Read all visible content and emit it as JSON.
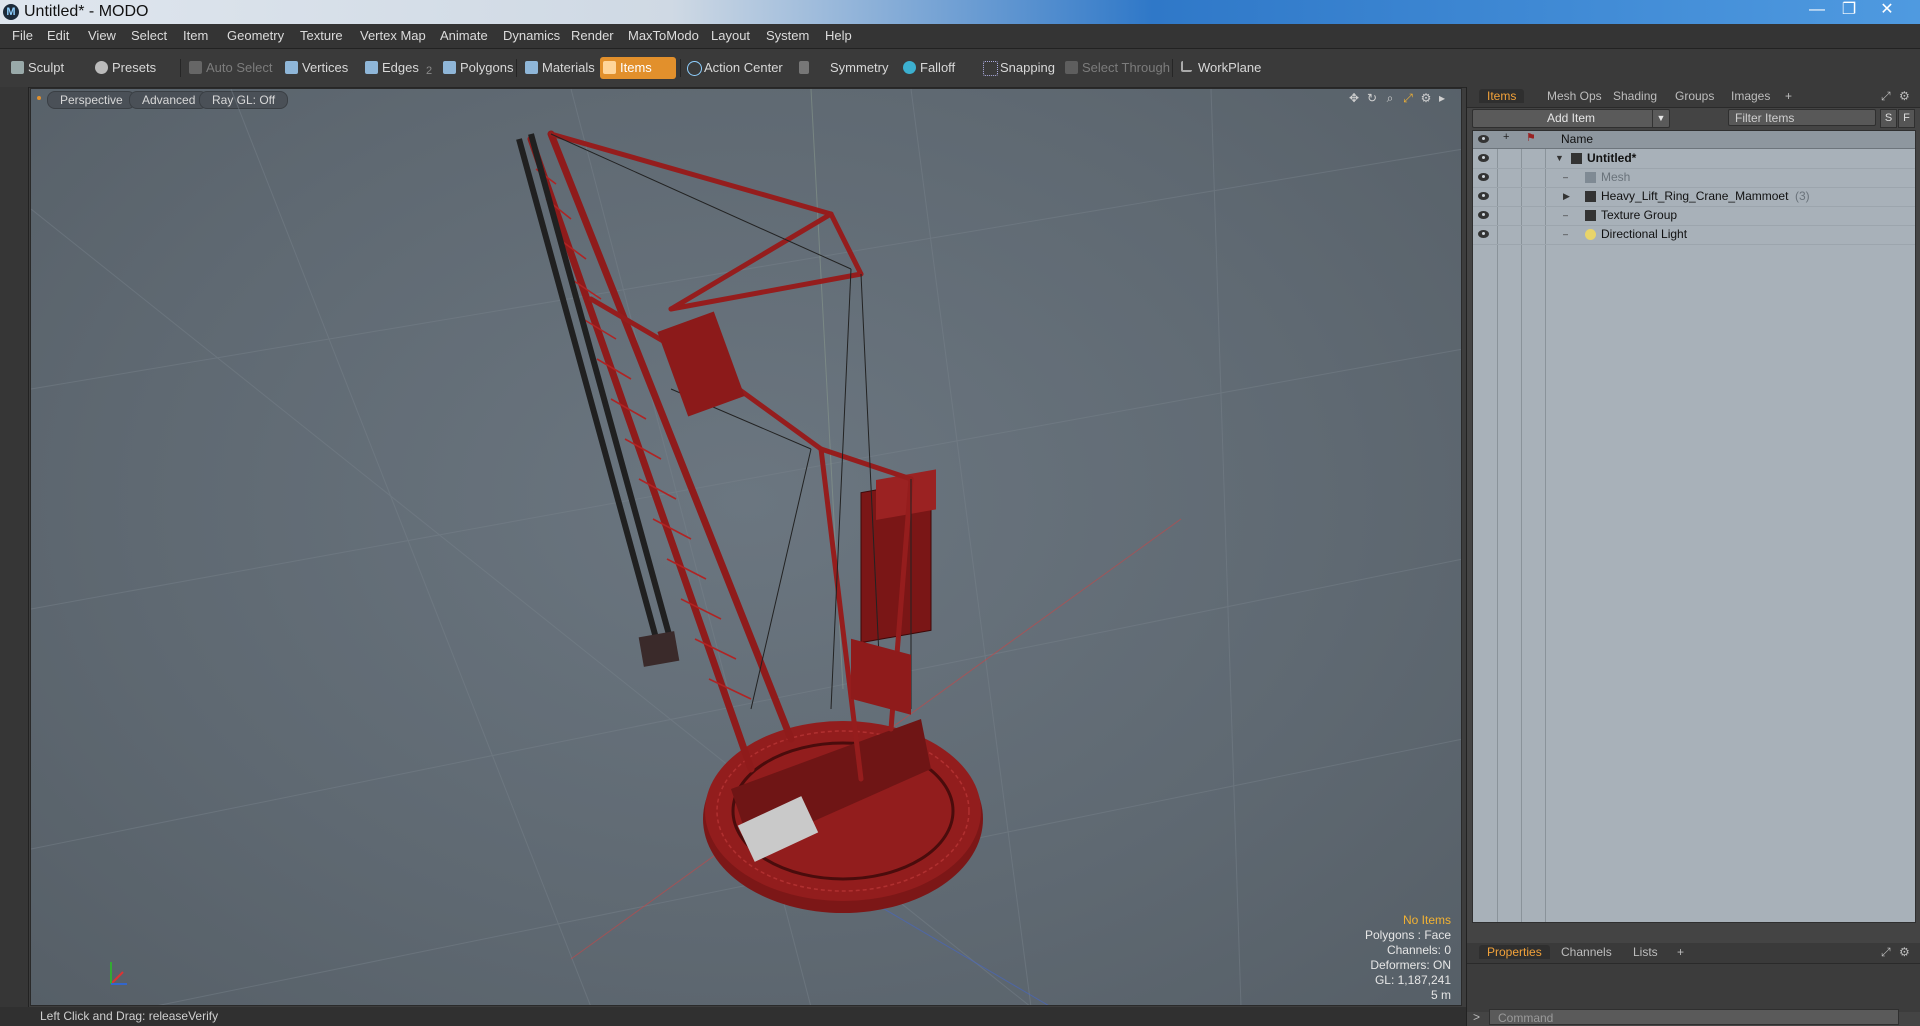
{
  "window": {
    "title": "Untitled* - MODO",
    "app_icon": "modo-icon",
    "buttons": [
      "—",
      "❐",
      "✕"
    ]
  },
  "menu": [
    "File",
    "Edit",
    "View",
    "Select",
    "Item",
    "Geometry",
    "Texture",
    "Vertex Map",
    "Animate",
    "Dynamics",
    "Render",
    "MaxToModo",
    "Layout",
    "System",
    "Help"
  ],
  "toolbar": {
    "sculpt": "Sculpt",
    "presets": "Presets",
    "auto_select": "Auto Select",
    "vertices": "Vertices",
    "edges": "Edges",
    "edges_count": "2",
    "polygons": "Polygons",
    "materials": "Materials",
    "items": "Items",
    "action_center": "Action Center",
    "symmetry": "Symmetry",
    "falloff": "Falloff",
    "snapping": "Snapping",
    "select_through": "Select Through",
    "workplane": "WorkPlane"
  },
  "viewport": {
    "tabs": [
      "Perspective",
      "Advanced",
      "Ray GL: Off"
    ],
    "info": {
      "selection": "No Items",
      "polygons": "Polygons : Face",
      "channels": "Channels: 0",
      "deformers": "Deformers: ON",
      "gl": "GL: 1,187,241",
      "scale": "5 m"
    },
    "colors": {
      "crane_red": "#8f1b1b",
      "crane_dark": "#5a0f0f",
      "boom_black": "#222222"
    }
  },
  "status": "Left Click and Drag:  releaseVerify",
  "items_panel": {
    "tabs": [
      "Items",
      "Mesh Ops",
      "Shading",
      "Groups",
      "Images",
      "+"
    ],
    "add_item": "Add Item",
    "filter_placeholder": "Filter Items",
    "btn_s": "S",
    "btn_f": "F",
    "column_name": "Name",
    "rows": [
      {
        "label": "Untitled*",
        "indent": 0,
        "expanded": "▼"
      },
      {
        "label": "Mesh",
        "indent": 1,
        "expanded": ""
      },
      {
        "label": "Heavy_Lift_Ring_Crane_Mammoet",
        "count": "(3)",
        "indent": 1,
        "expanded": "▶"
      },
      {
        "label": "Texture Group",
        "indent": 1,
        "expanded": ""
      },
      {
        "label": "Directional Light",
        "indent": 1,
        "expanded": ""
      }
    ]
  },
  "properties_panel": {
    "tabs": [
      "Properties",
      "Channels",
      "Lists",
      "+"
    ],
    "command_placeholder": "Command"
  }
}
